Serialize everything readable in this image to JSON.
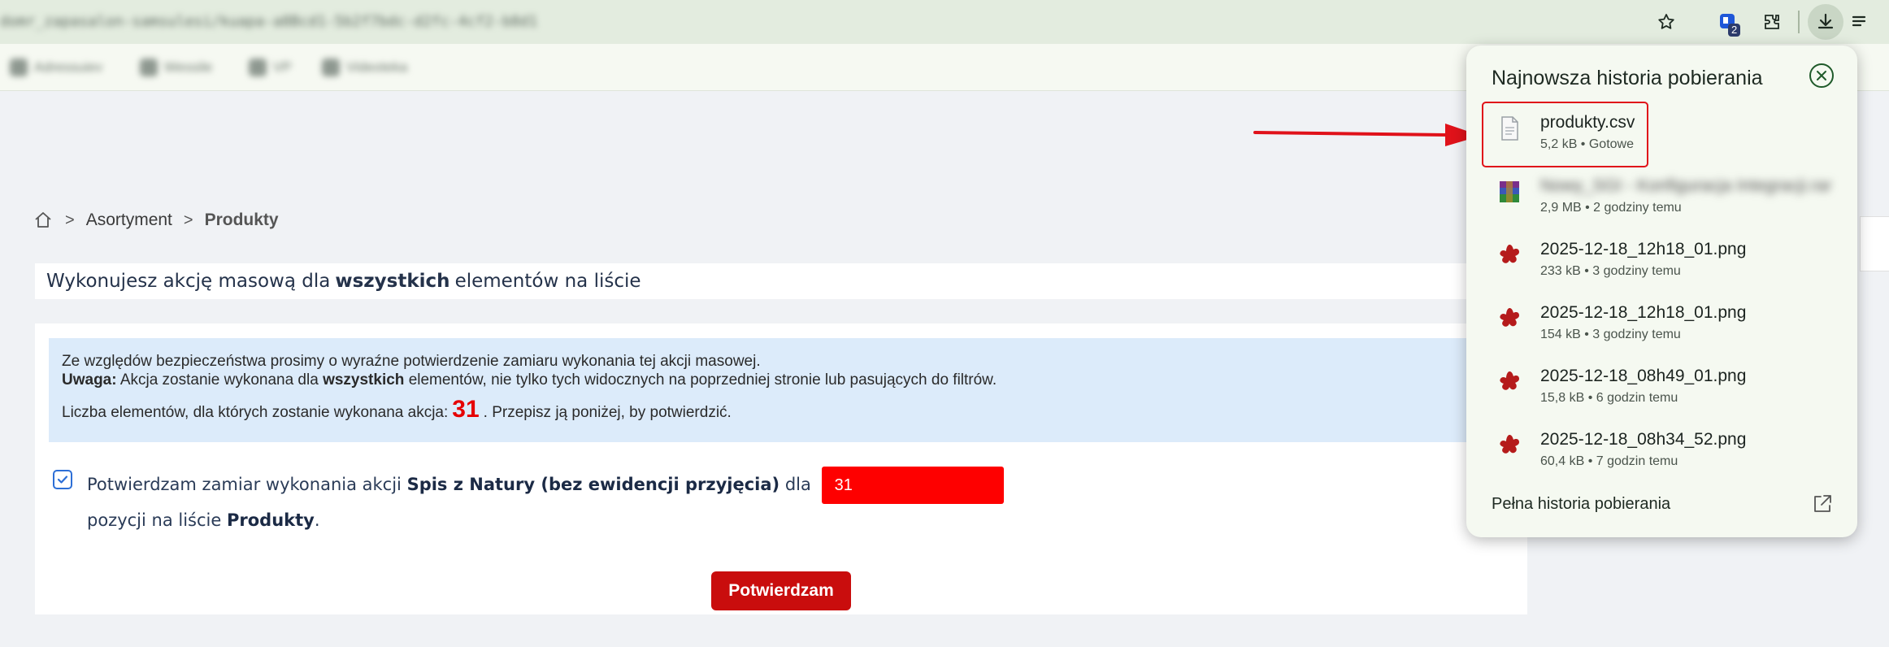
{
  "browser": {
    "url": "domr_zapasalon-samsulesi/kuapa-a8Bcd1-5b2f7bdc-d2fc-4cf2-b8d1",
    "extensions_badge": "2",
    "bookmarks": [
      "Adressuiev",
      "Wessile",
      "VP",
      "Videoteka"
    ]
  },
  "breadcrumb": {
    "items": [
      "Asortyment",
      "Produkty"
    ],
    "separator": ">"
  },
  "header": {
    "prefix": "Wykonujesz akcję masową dla",
    "bold": "wszystkich",
    "suffix": "elementów na liście"
  },
  "info": {
    "line1": "Ze względów bezpieczeństwa prosimy o wyraźne potwierdzenie zamiaru wykonania tej akcji masowej.",
    "warning_label": "Uwaga:",
    "line2_a": "Akcja zostanie wykonana dla",
    "line2_bold": "wszystkich",
    "line2_b": "elementów, nie tylko tych widocznych na poprzedniej stronie lub pasujących do filtrów.",
    "count_prefix": "Liczba elementów, dla których zostanie wykonana akcja:",
    "count": "31",
    "count_suffix": ". Przepisz ją poniżej, by potwierdzić."
  },
  "confirm": {
    "text_a": "Potwierdzam zamiar wykonania akcji",
    "action_name": "Spis z Natury (bez ewidencji przyjęcia)",
    "text_b": "dla",
    "input_value": "31",
    "text_c": "pozycji na liście",
    "list_name": "Produkty",
    "text_d": ".",
    "checked": true,
    "button_label": "Potwierdzam"
  },
  "downloads": {
    "title": "Najnowsza historia pobierania",
    "items": [
      {
        "name": "produkty.csv",
        "meta": "5,2 kB • Gotowe",
        "icon": "csv-file-icon"
      },
      {
        "name": "Nowy_SGI - Konfiguracja Integracji.rar",
        "meta": "2,9 MB • 2 godziny temu",
        "icon": "winrar-archive-icon",
        "blurred": true
      },
      {
        "name": "2025-12-18_12h18_01.png",
        "meta": "233 kB • 3 godziny temu",
        "icon": "greenshot-image-icon"
      },
      {
        "name": "2025-12-18_12h18_01.png",
        "meta": "154 kB • 3 godziny temu",
        "icon": "greenshot-image-icon"
      },
      {
        "name": "2025-12-18_08h49_01.png",
        "meta": "15,8 kB • 6 godzin temu",
        "icon": "greenshot-image-icon"
      },
      {
        "name": "2025-12-18_08h34_52.png",
        "meta": "60,4 kB • 7 godzin temu",
        "icon": "greenshot-image-icon"
      }
    ],
    "footer_label": "Pełna historia pobierania"
  },
  "colors": {
    "accent_red": "#c90d0d",
    "count_red": "#e60000",
    "info_bg": "#dcebfa",
    "highlight": "#e0121a"
  }
}
